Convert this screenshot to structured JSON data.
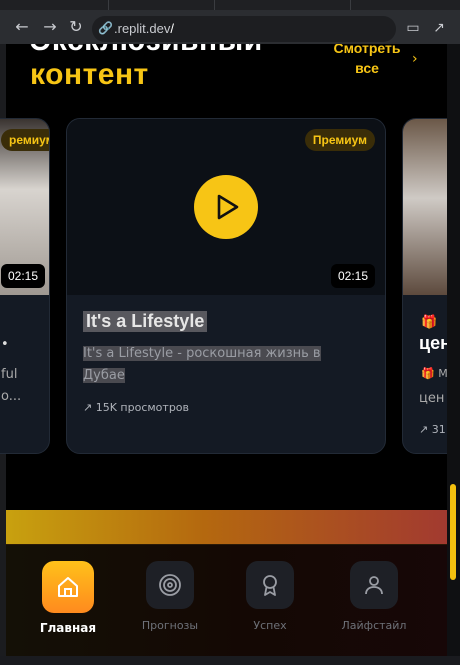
{
  "browser": {
    "url_prefix": ".replit.dev",
    "url_suffix": "/",
    "icons": [
      "back-icon",
      "forward-icon",
      "reload-icon",
      "link-icon",
      "cast-icon",
      "open-external-icon"
    ]
  },
  "section": {
    "title_line1": "Эксклюзивный",
    "title_line2": "контент",
    "see_all_line1": "Смотреть",
    "see_all_line2": "все",
    "accent": "#f7c515"
  },
  "cards": {
    "left": {
      "badge": "ремиум",
      "duration": "02:15",
      "text1": "•",
      "text2": "ful",
      "text3": "o..."
    },
    "main": {
      "badge": "Премиум",
      "duration": "02:15",
      "title": "It's a Lifestyle",
      "description": "It's a Lifestyle - роскошная жизнь в Дубае",
      "views": "15K просмотров"
    },
    "right": {
      "emoji": "🎁",
      "title": "цен",
      "emoji2_text": "M",
      "text": "цен",
      "views": "31"
    }
  },
  "bottom_nav": {
    "items": [
      {
        "label": "Главная",
        "icon": "home-icon",
        "active": true
      },
      {
        "label": "Прогнозы",
        "icon": "target-icon",
        "active": false
      },
      {
        "label": "Успех",
        "icon": "award-icon",
        "active": false
      },
      {
        "label": "Лайфстайл",
        "icon": "user-icon",
        "active": false
      }
    ]
  }
}
